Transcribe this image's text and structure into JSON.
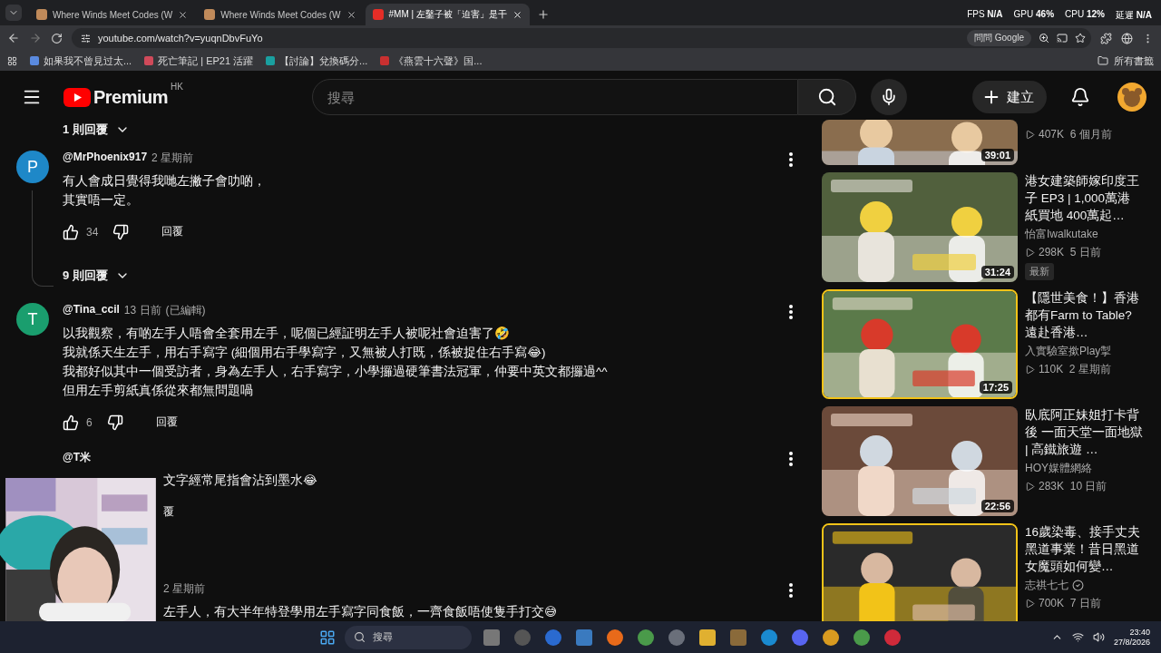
{
  "browser": {
    "tabs": [
      {
        "title": "Where Winds Meet Codes (W",
        "selected": false
      },
      {
        "title": "Where Winds Meet Codes (W",
        "selected": false
      },
      {
        "title": "#MM | 左鑿子被「迫害」是干",
        "selected": true
      }
    ],
    "url": "youtube.com/watch?v=yuqnDbvFuYo",
    "ask_google": "問問 Google",
    "bookmarks": [
      "如果我不曾見过太...",
      "死亡筆記 | EP21 活躍",
      "【討論】兌換碼分...",
      "《燕雲十六聲》国..."
    ],
    "all_bookmarks": "所有書籤"
  },
  "overlay_stats": [
    {
      "label": "FPS",
      "value": "N/A"
    },
    {
      "label": "GPU",
      "value": "46%"
    },
    {
      "label": "CPU",
      "value": "12%"
    },
    {
      "label": "延遲",
      "value": "N/A"
    }
  ],
  "youtube": {
    "logo": "Premium",
    "region": "HK",
    "search": {
      "placeholder": "搜尋"
    },
    "create": "建立"
  },
  "top_replies": "1 則回覆",
  "comments": [
    {
      "kind": "full",
      "avatar": "P",
      "color": "#1e88c8",
      "author": "@MrPhoenix917",
      "time": "2 星期前",
      "lines": [
        "有人會成日覺得我哋左撇子會叻啲，",
        "其實唔一定。"
      ],
      "likes": "34",
      "reply": "回覆",
      "replies": "9 則回覆"
    },
    {
      "kind": "full",
      "avatar": "T",
      "color": "#1a9e6e",
      "author": "@Tina_ccil",
      "time": "13 日前",
      "edited": "(已編輯)",
      "lines": [
        "以我觀察，有啲左手人唔會全套用左手，呢個已經証明左手人被呢社會迫害了🤣",
        "我就係天生左手，用右手寫字 (細個用右手學寫字，又無被人打既，係被捉住右手寫😂)",
        "我都好似其中一個受訪者，身為左手人，右手寫字，小學攞過硬筆書法冠軍，仲要中英文都攞過^^",
        "但用左手剪紙真係從來都無問題喎"
      ],
      "likes": "6",
      "reply": "回覆"
    },
    {
      "kind": "covered",
      "author": "@T米",
      "lines": [
        "文字經常尾指會沾到墨水😂"
      ],
      "reply": "覆"
    },
    {
      "kind": "covered",
      "time": "2 星期前",
      "lines": [
        "左手人，有大半年特登學用左手寫字同食飯，一齊食飯唔使隻手打交😅"
      ]
    }
  ],
  "related": [
    {
      "kind": "partial",
      "duration": "39:01",
      "views": "407K",
      "age": "6 個月前"
    },
    {
      "kind": "full",
      "duration": "31:24",
      "title": "港女建築師嫁印度王子 EP3 | 1,000萬港紙買地 400萬起…",
      "channel": "怡富Iwalkutake",
      "views": "298K",
      "age": "5 日前",
      "badge": "最新"
    },
    {
      "kind": "full",
      "duration": "17:25",
      "title": "【隱世美食！】香港都有Farm to Table? 遠赴香港…",
      "channel": "入實驗室撳Play掣",
      "views": "110K",
      "age": "2 星期前"
    },
    {
      "kind": "full",
      "duration": "22:56",
      "title": "臥底阿正妹姐打卡背後 一面天堂一面地獄 | 高鐵旅遊 …",
      "channel": "HOY媒體網絡",
      "views": "283K",
      "age": "10 日前"
    },
    {
      "kind": "full",
      "title": "16歲染毒、接手丈夫黑道事業！昔日黑道女魔頭如何變…",
      "channel": "志祺七七",
      "verified": true,
      "views": "700K",
      "age": "7 日前"
    }
  ],
  "taskbar": {
    "search": {
      "placeholder": "搜尋"
    },
    "time": "23:40",
    "date": "27/8/2026"
  }
}
